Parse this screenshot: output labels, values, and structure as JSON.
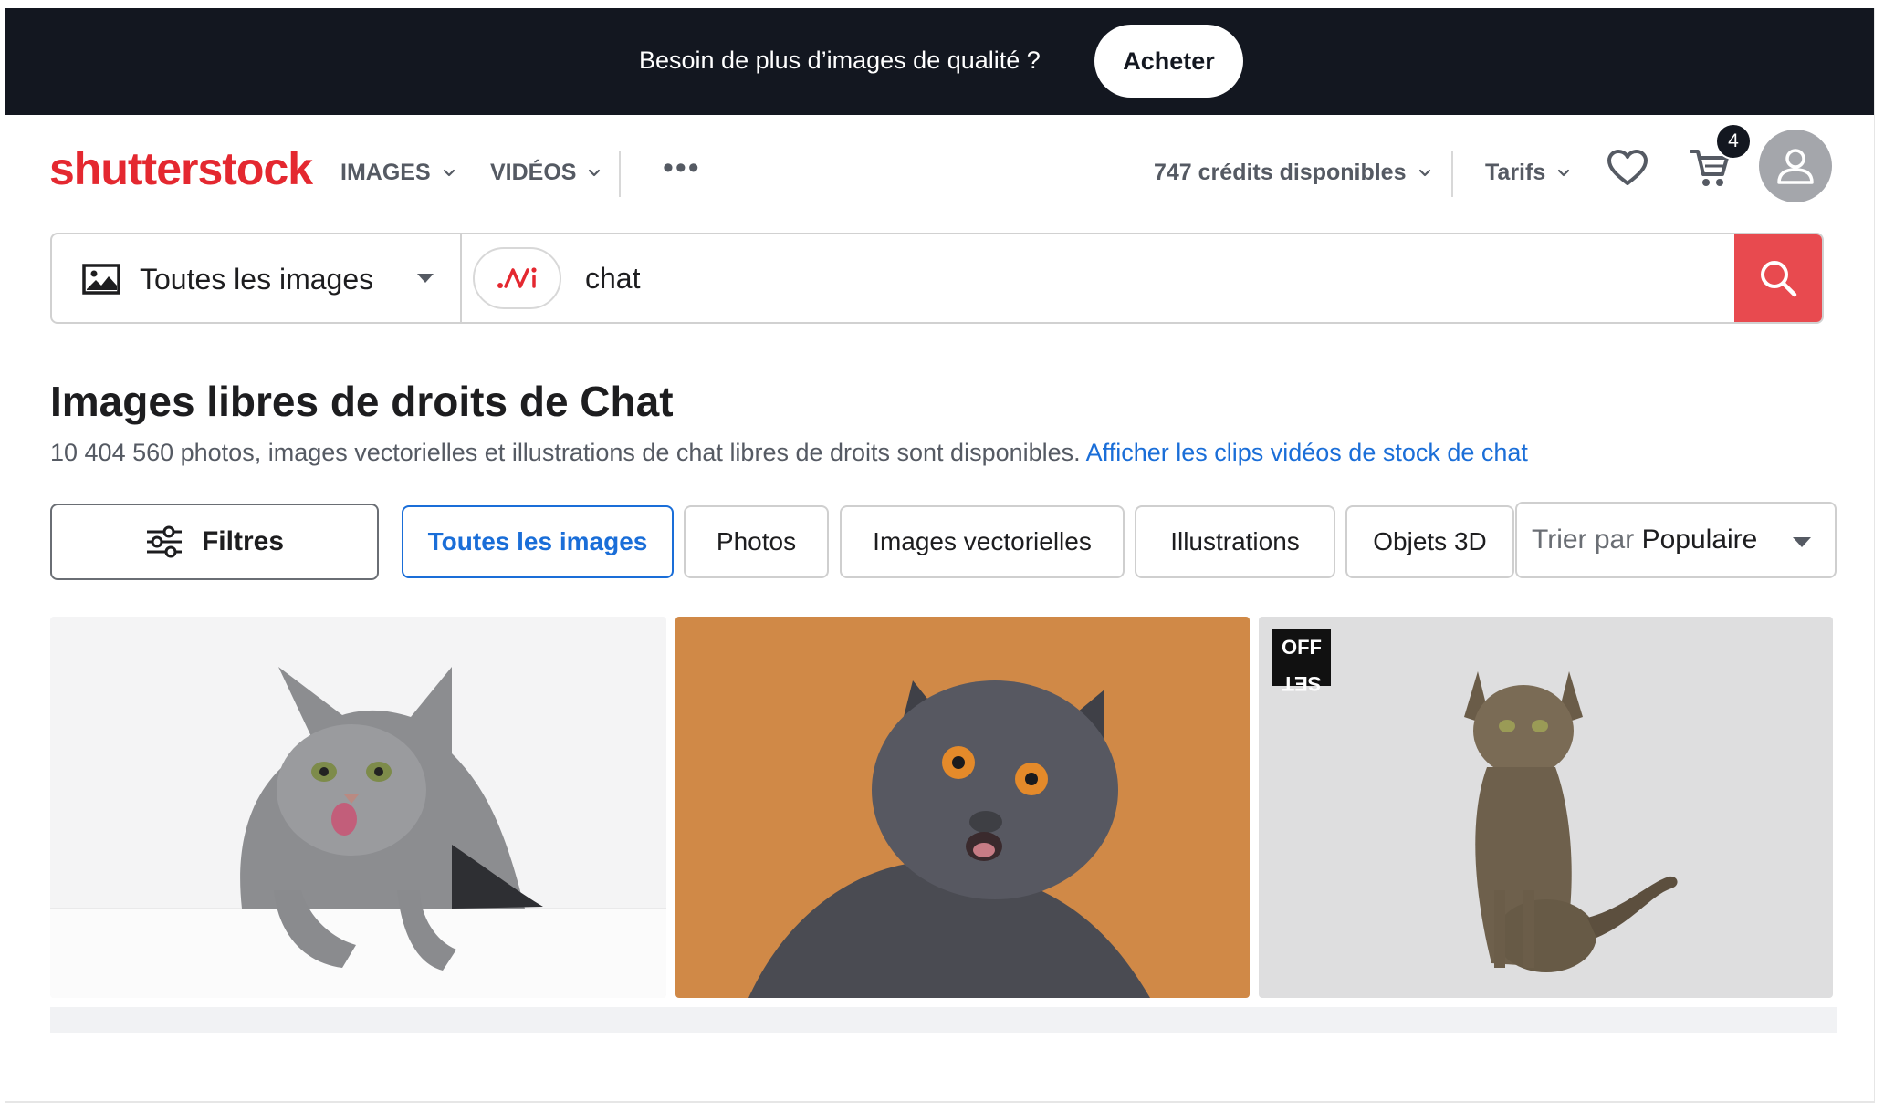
{
  "banner": {
    "text": "Besoin de plus d’images de qualité ?",
    "button": "Acheter"
  },
  "header": {
    "logo": "shutterstock",
    "nav": [
      {
        "label": "IMAGES"
      },
      {
        "label": "VIDÉOS"
      }
    ],
    "more": "•••",
    "credits": "747 crédits disponibles",
    "pricing": "Tarifs",
    "cart_count": "4"
  },
  "search": {
    "type_label": "Toutes les images",
    "query": "chat",
    "placeholder": ""
  },
  "results": {
    "title": "Images libres de droits de Chat",
    "count_text": "10 404 560 photos, images vectorielles et illustrations de chat libres de droits sont disponibles.",
    "video_link": "Afficher les clips vidéos de stock de chat"
  },
  "filters": {
    "button": "Filtres",
    "chips": [
      {
        "label": "Toutes les images",
        "active": true
      },
      {
        "label": "Photos",
        "active": false
      },
      {
        "label": "Images vectorielles",
        "active": false
      },
      {
        "label": "Illustrations",
        "active": false
      },
      {
        "label": "Objets 3D",
        "active": false
      }
    ],
    "sort_prefix": "Trier par",
    "sort_value": "Populaire"
  },
  "images": [
    {
      "subject": "grey tabby cat licking lips on white"
    },
    {
      "subject": "british shorthair cat on orange background"
    },
    {
      "subject": "tabby cat sitting on light grey",
      "badge": "OFF SET"
    }
  ],
  "colors": {
    "brand": "#e42830",
    "banner_bg": "#131720",
    "link": "#1a6ed8",
    "search_button": "#e84a4f"
  }
}
